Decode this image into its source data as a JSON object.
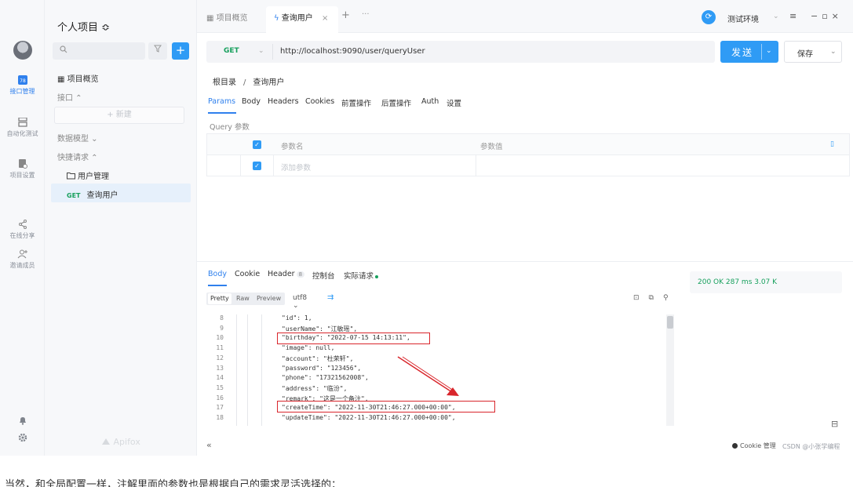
{
  "rail": {
    "items": [
      {
        "label": "接口管理",
        "icon": "api-doc-icon"
      },
      {
        "label": "自动化测试",
        "icon": "server-stack-icon"
      },
      {
        "label": "项目设置",
        "icon": "project-settings-icon"
      },
      {
        "label": "在线分享",
        "icon": "share-icon"
      },
      {
        "label": "邀请成员",
        "icon": "add-member-icon"
      }
    ],
    "bottom_icons": [
      "notification-bell-icon",
      "settings-gear-icon"
    ],
    "accent_color": "#2f80ed"
  },
  "tree": {
    "project_title": "个人项目 ≎",
    "overview": "▦ 项目概览",
    "interfaces": "接口 ⌃",
    "new_button": "+ 新建",
    "data_models": "数据模型 ⌄",
    "quick_requests": "快捷请求 ⌃",
    "folder": "用户管理",
    "selected_method": "GET",
    "selected_item": "查询用户",
    "brand": "Apifox"
  },
  "tabs": {
    "overview": "▦ 项目概览",
    "active": "查询用户",
    "environment": "测试环境"
  },
  "request": {
    "method": "GET",
    "url": "http://localhost:9090/user/queryUser",
    "send_label": "发送",
    "save_label": "保存",
    "breadcrumb_root": "根目录",
    "breadcrumb_current": "查询用户",
    "tabs": [
      "Params",
      "Body",
      "Headers",
      "Cookies",
      "前置操作",
      "后置操作",
      "Auth",
      "设置"
    ],
    "query_label": "Query 参数",
    "param_header_name": "参数名",
    "param_header_value": "参数值",
    "param_placeholder": "添加参数",
    "bulk_edit": "▯"
  },
  "response": {
    "tabs": [
      "Body",
      "Cookie",
      "Header",
      "控制台",
      "实际请求"
    ],
    "header_count": "8",
    "status_line": "200 OK  287 ms  3.07 K",
    "formats": [
      "Pretty",
      "Raw",
      "Preview"
    ],
    "encoding": "utf8 ⌄",
    "lines": [
      {
        "n": "8",
        "text": "\"id\": 1,"
      },
      {
        "n": "9",
        "text": "\"userName\": \"江敏瑶\","
      },
      {
        "n": "10",
        "text": "\"birthday\": \"2022-07-15 14:13:11\","
      },
      {
        "n": "11",
        "text": "\"image\": null,"
      },
      {
        "n": "12",
        "text": "\"account\": \"杜荣轩\","
      },
      {
        "n": "13",
        "text": "\"password\": \"123456\","
      },
      {
        "n": "14",
        "text": "\"phone\": \"17321562008\","
      },
      {
        "n": "15",
        "text": "\"address\": \"临汾\","
      },
      {
        "n": "16",
        "text": "\"remark\": \"这是一个备注\","
      },
      {
        "n": "17",
        "text": "\"createTime\": \"2022-11-30T21:46:27.000+00:00\","
      },
      {
        "n": "18",
        "text": "\"updateTime\": \"2022-11-30T21:46:27.000+00:00\","
      }
    ],
    "annotation_color": "#d9262c"
  },
  "footer": {
    "cookie_manager": "Cookie 管理",
    "watermark": "CSDN @小张学编程"
  },
  "caption": "当然，和全局配置一样，注解里面的参数也是根据自己的需求灵活选择的："
}
